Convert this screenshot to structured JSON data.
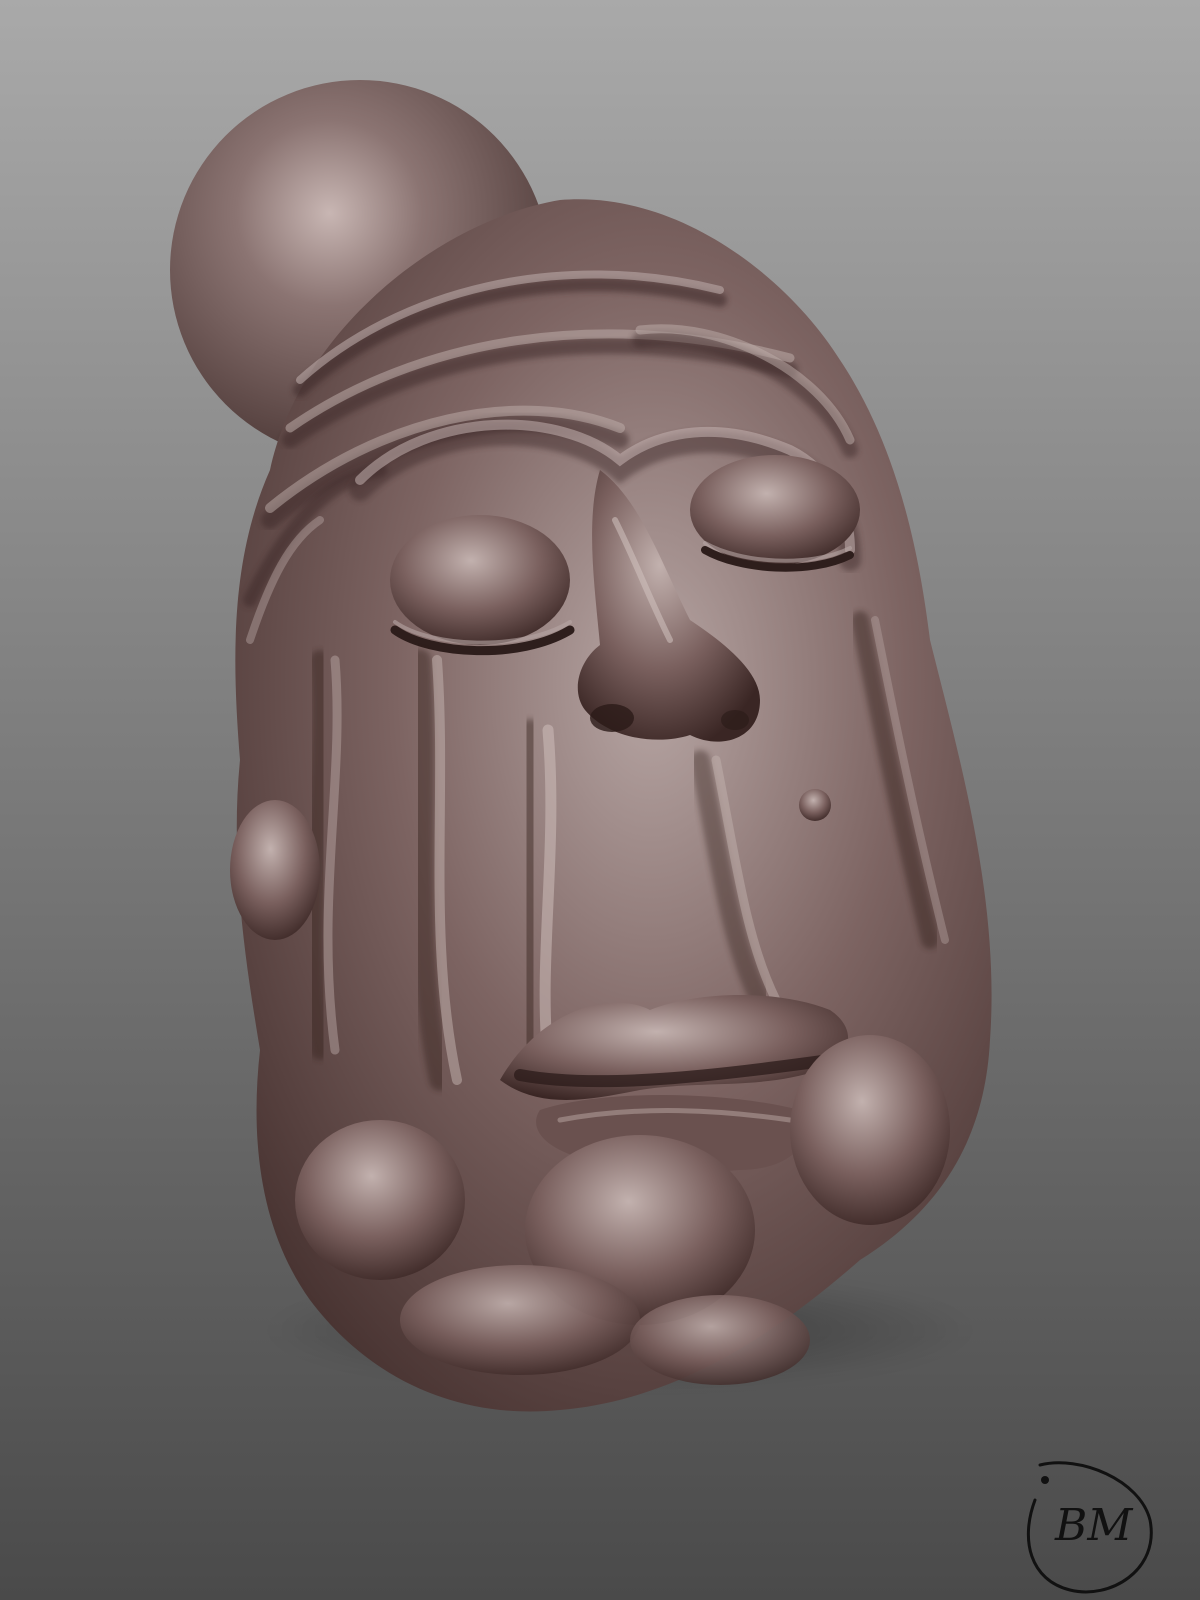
{
  "scene": {
    "subject": "sculpted-grotesque-head",
    "background_top": "#a9a9a9",
    "background_bottom": "#4a4a4a",
    "clay_light": "#b7a6a4",
    "clay_mid": "#7d6462",
    "clay_dark": "#3e2a28",
    "sphere_color": "#8b7472"
  },
  "signature": {
    "text": "BM",
    "color": "#111111"
  }
}
